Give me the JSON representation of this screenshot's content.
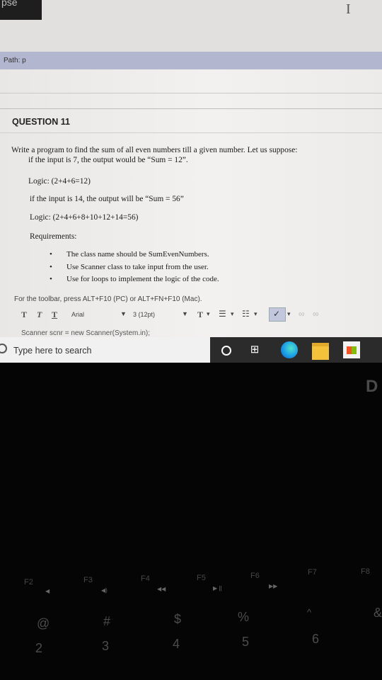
{
  "window": {
    "tab_fragment": "pse",
    "cursor_glyph": "I"
  },
  "path": {
    "label": "Path: p"
  },
  "question": {
    "title": "QUESTION 11",
    "prompt_line1": "Write a program to find the sum of all even numbers till a given number. Let us suppose:",
    "prompt_line2": "if the input is 7, the output would be “Sum = 12”.",
    "logic1": "Logic: (2+4+6=12)",
    "example2": "if the input is 14, the output will be “Sum = 56”",
    "logic2": "Logic: (2+4+6+8+10+12+14=56)",
    "requirements_label": "Requirements:",
    "requirements": [
      "The class name should be SumEvenNumbers.",
      "Use Scanner class to take input from the user.",
      "Use for loops to implement the logic of the code."
    ]
  },
  "editor": {
    "toolbar_hint": "For the toolbar, press ALT+F10 (PC) or ALT+FN+F10 (Mac).",
    "toolbar": {
      "font": "Arial",
      "size": "3 (12pt)",
      "fmt1": "T",
      "fmt2": "T",
      "fmt3": "T",
      "text_color": "T"
    },
    "content_line": "Scanner scnr = new Scanner(System.in);"
  },
  "taskbar": {
    "search_placeholder": "Type here to search",
    "taskview_glyph": "⊞"
  },
  "keyboard": {
    "bezel_letter": "D",
    "fkeys": [
      "F2",
      "F3",
      "F4",
      "F5",
      "F6",
      "F7",
      "F8"
    ],
    "fsyms": [
      "◀",
      "◀)",
      "◀◀",
      "▶ ||",
      "▶▶"
    ],
    "top_symbols": [
      "@",
      "#",
      "$",
      "%",
      "^",
      "&"
    ],
    "numbers": [
      "2",
      "3",
      "4",
      "5",
      "6"
    ]
  },
  "colors": {
    "path_bar": "#b3b6cf",
    "taskbar": "#2b2b2b",
    "keyboard": "#050505"
  }
}
